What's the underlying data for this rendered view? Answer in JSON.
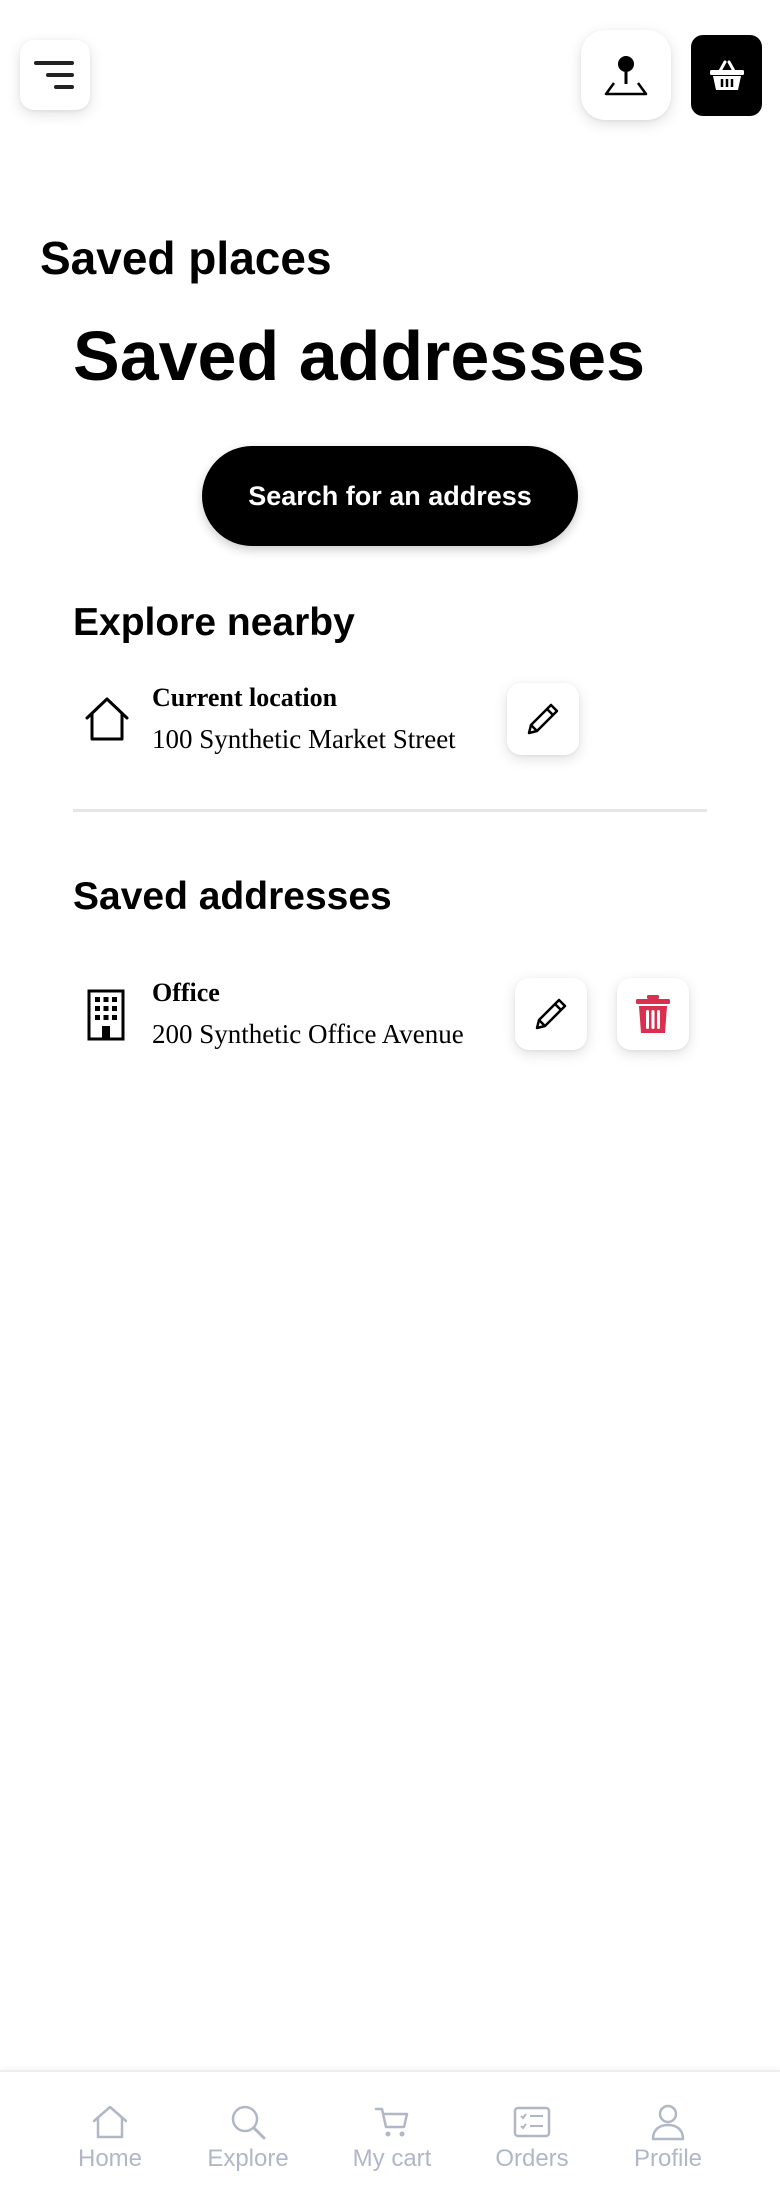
{
  "header": {
    "menu_icon": "menu-lines-icon",
    "map_icon": "map-pin-icon",
    "cart_icon": "basket-icon"
  },
  "screen_title": "Saved places",
  "page_heading": "Saved addresses",
  "search_button_label": "Search for an address",
  "explore": {
    "heading": "Explore nearby",
    "item": {
      "title": "Current location",
      "address": "100 Synthetic Market Street",
      "icon": "house-icon"
    }
  },
  "saved": {
    "heading": "Saved addresses",
    "items": [
      {
        "title": "Office",
        "address": "200 Synthetic Office Avenue",
        "icon": "building-icon"
      }
    ]
  },
  "colors": {
    "primary": "#000000",
    "delete": "#d9304f",
    "nav_inactive": "#b0b8c8",
    "divider": "#e6e6e6"
  },
  "bottom_nav": {
    "items": [
      {
        "label": "Home",
        "icon": "home-icon"
      },
      {
        "label": "Explore",
        "icon": "search-icon"
      },
      {
        "label": "My cart",
        "icon": "cart-icon"
      },
      {
        "label": "Orders",
        "icon": "orders-icon"
      },
      {
        "label": "Profile",
        "icon": "profile-icon"
      }
    ]
  }
}
